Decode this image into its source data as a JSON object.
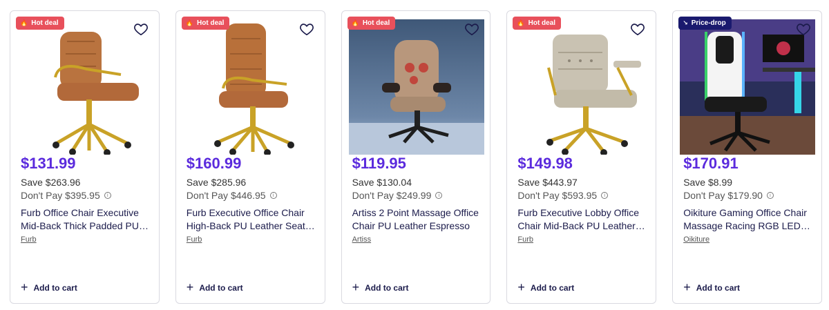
{
  "colors": {
    "price": "#5b2bdd",
    "hot_badge": "#e8505b",
    "price_drop_badge": "#1a1a6e"
  },
  "products": [
    {
      "badge": "Hot deal",
      "badge_type": "hot",
      "badge_icon": "flame-icon",
      "price": "$131.99",
      "save": "Save $263.96",
      "dont_pay": "Don't Pay $395.95",
      "title": "Furb Office Chair Executive Mid-Back Thick Padded PU Leather",
      "brand": "Furb",
      "cart": "Add to cart"
    },
    {
      "badge": "Hot deal",
      "badge_type": "hot",
      "badge_icon": "flame-icon",
      "price": "$160.99",
      "save": "Save $285.96",
      "dont_pay": "Don't Pay $446.95",
      "title": "Furb Executive Office Chair High-Back PU Leather Seat Tan",
      "brand": "Furb",
      "cart": "Add to cart"
    },
    {
      "badge": "Hot deal",
      "badge_type": "hot",
      "badge_icon": "flame-icon",
      "price": "$119.95",
      "save": "Save $130.04",
      "dont_pay": "Don't Pay $249.99",
      "title": "Artiss 2 Point Massage Office Chair PU Leather Espresso",
      "brand": "Artiss",
      "cart": "Add to cart"
    },
    {
      "badge": "Hot deal",
      "badge_type": "hot",
      "badge_icon": "flame-icon",
      "price": "$149.98",
      "save": "Save $443.97",
      "dont_pay": "Don't Pay $593.95",
      "title": "Furb Executive Lobby Office Chair Mid-Back PU Leather Gold",
      "brand": "Furb",
      "cart": "Add to cart"
    },
    {
      "badge": "Price-drop",
      "badge_type": "drop",
      "badge_icon": "trend-down-icon",
      "price": "$170.91",
      "save": "Save $8.99",
      "dont_pay": "Don't Pay $179.90",
      "title": "Oikiture Gaming Office Chair Massage Racing RGB LED Lights",
      "brand": "Oikiture",
      "cart": "Add to cart"
    }
  ]
}
